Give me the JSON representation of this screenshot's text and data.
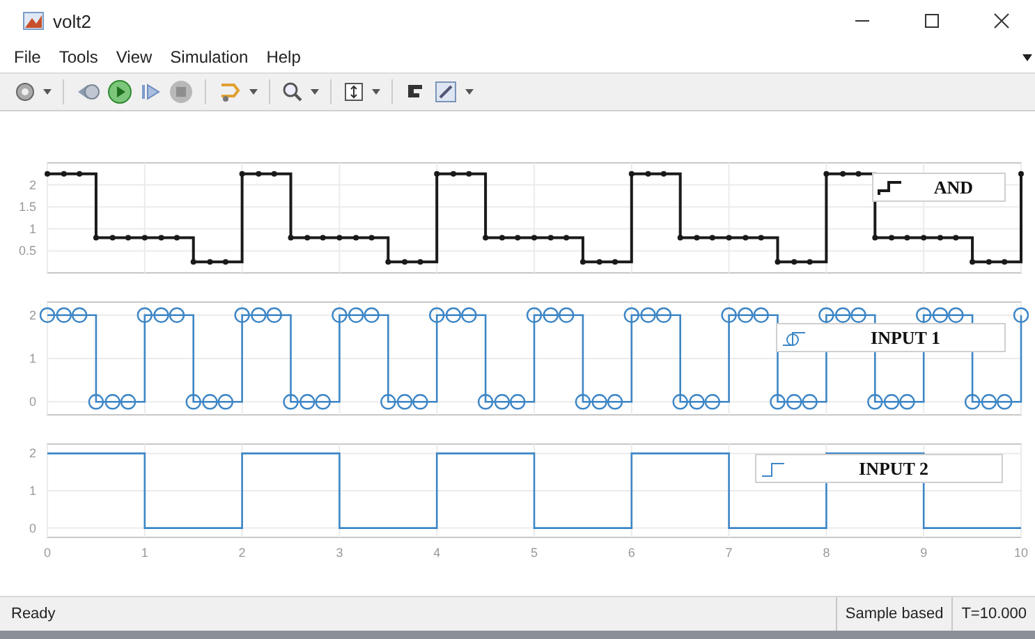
{
  "window": {
    "title": "volt2"
  },
  "menu": [
    "File",
    "Tools",
    "View",
    "Simulation",
    "Help"
  ],
  "plots": [
    {
      "chart_data": {
        "type": "line",
        "grid": true,
        "xlim": [
          0,
          10
        ],
        "ylim": [
          0,
          2.5
        ],
        "yticks": [
          0.5,
          1,
          1.5,
          2
        ],
        "x": [
          0,
          0.17,
          0.33,
          0.5,
          0.5,
          0.67,
          0.83,
          1,
          1.17,
          1.33,
          1.5,
          1.5,
          1.67,
          1.83,
          2,
          2,
          2.17,
          2.33,
          2.5,
          2.5,
          2.67,
          2.83,
          3,
          3.17,
          3.33,
          3.5,
          3.5,
          3.67,
          3.83,
          4,
          4,
          4.17,
          4.33,
          4.5,
          4.5,
          4.67,
          4.83,
          5,
          5.17,
          5.33,
          5.5,
          5.5,
          5.67,
          5.83,
          6,
          6,
          6.17,
          6.33,
          6.5,
          6.5,
          6.67,
          6.83,
          7,
          7.17,
          7.33,
          7.5,
          7.5,
          7.67,
          7.83,
          8,
          8,
          8.17,
          8.33,
          8.5,
          8.5,
          8.67,
          8.83,
          9,
          9.17,
          9.33,
          9.5,
          9.5,
          9.67,
          9.83,
          10,
          10
        ],
        "series": [
          {
            "name": "AND",
            "color": "#1a1a1a",
            "marker": "dot",
            "values": [
              2.25,
              2.25,
              2.25,
              2.25,
              0.8,
              0.8,
              0.8,
              0.8,
              0.8,
              0.8,
              0.8,
              0.25,
              0.25,
              0.25,
              0.25,
              2.25,
              2.25,
              2.25,
              2.25,
              0.8,
              0.8,
              0.8,
              0.8,
              0.8,
              0.8,
              0.8,
              0.25,
              0.25,
              0.25,
              0.25,
              2.25,
              2.25,
              2.25,
              2.25,
              0.8,
              0.8,
              0.8,
              0.8,
              0.8,
              0.8,
              0.8,
              0.25,
              0.25,
              0.25,
              0.25,
              2.25,
              2.25,
              2.25,
              2.25,
              0.8,
              0.8,
              0.8,
              0.8,
              0.8,
              0.8,
              0.8,
              0.25,
              0.25,
              0.25,
              0.25,
              2.25,
              2.25,
              2.25,
              2.25,
              0.8,
              0.8,
              0.8,
              0.8,
              0.8,
              0.8,
              0.8,
              0.25,
              0.25,
              0.25,
              0.25,
              2.25
            ]
          }
        ]
      }
    },
    {
      "chart_data": {
        "type": "line",
        "grid": true,
        "xlim": [
          0,
          10
        ],
        "ylim": [
          -0.3,
          2.3
        ],
        "yticks": [
          0,
          1,
          2
        ],
        "x": [
          0,
          0.17,
          0.33,
          0.5,
          0.5,
          0.67,
          0.83,
          1,
          1,
          1.17,
          1.33,
          1.5,
          1.5,
          1.67,
          1.83,
          2,
          2,
          2.17,
          2.33,
          2.5,
          2.5,
          2.67,
          2.83,
          3,
          3,
          3.17,
          3.33,
          3.5,
          3.5,
          3.67,
          3.83,
          4,
          4,
          4.17,
          4.33,
          4.5,
          4.5,
          4.67,
          4.83,
          5,
          5,
          5.17,
          5.33,
          5.5,
          5.5,
          5.67,
          5.83,
          6,
          6,
          6.17,
          6.33,
          6.5,
          6.5,
          6.67,
          6.83,
          7,
          7,
          7.17,
          7.33,
          7.5,
          7.5,
          7.67,
          7.83,
          8,
          8,
          8.17,
          8.33,
          8.5,
          8.5,
          8.67,
          8.83,
          9,
          9,
          9.17,
          9.33,
          9.5,
          9.5,
          9.67,
          9.83,
          10,
          10
        ],
        "series": [
          {
            "name": "INPUT 1",
            "color": "#3d86c6",
            "marker": "circle",
            "values": [
              2,
              2,
              2,
              2,
              0,
              0,
              0,
              0,
              2,
              2,
              2,
              2,
              0,
              0,
              0,
              0,
              2,
              2,
              2,
              2,
              0,
              0,
              0,
              0,
              2,
              2,
              2,
              2,
              0,
              0,
              0,
              0,
              2,
              2,
              2,
              2,
              0,
              0,
              0,
              0,
              2,
              2,
              2,
              2,
              0,
              0,
              0,
              0,
              2,
              2,
              2,
              2,
              0,
              0,
              0,
              0,
              2,
              2,
              2,
              2,
              0,
              0,
              0,
              0,
              2,
              2,
              2,
              2,
              0,
              0,
              0,
              0,
              2,
              2,
              2,
              2,
              0,
              0,
              0,
              0,
              2
            ]
          }
        ]
      }
    },
    {
      "chart_data": {
        "type": "line",
        "grid": true,
        "xlim": [
          0,
          10
        ],
        "ylim": [
          -0.25,
          2.25
        ],
        "xticks": [
          0,
          1,
          2,
          3,
          4,
          5,
          6,
          7,
          8,
          9,
          10
        ],
        "yticks": [
          0,
          1,
          2
        ],
        "x": [
          0,
          1,
          1,
          2,
          2,
          3,
          3,
          4,
          4,
          5,
          5,
          6,
          6,
          7,
          7,
          8,
          8,
          9,
          9,
          10
        ],
        "series": [
          {
            "name": "INPUT 2",
            "color": "#3d86c6",
            "marker": "none",
            "values": [
              2,
              2,
              0,
              0,
              2,
              2,
              0,
              0,
              2,
              2,
              0,
              0,
              2,
              2,
              0,
              0,
              2,
              2,
              0,
              0
            ]
          }
        ]
      }
    }
  ],
  "status_bar": {
    "message": "Ready",
    "mode": "Sample based",
    "time": "T=10.000"
  }
}
